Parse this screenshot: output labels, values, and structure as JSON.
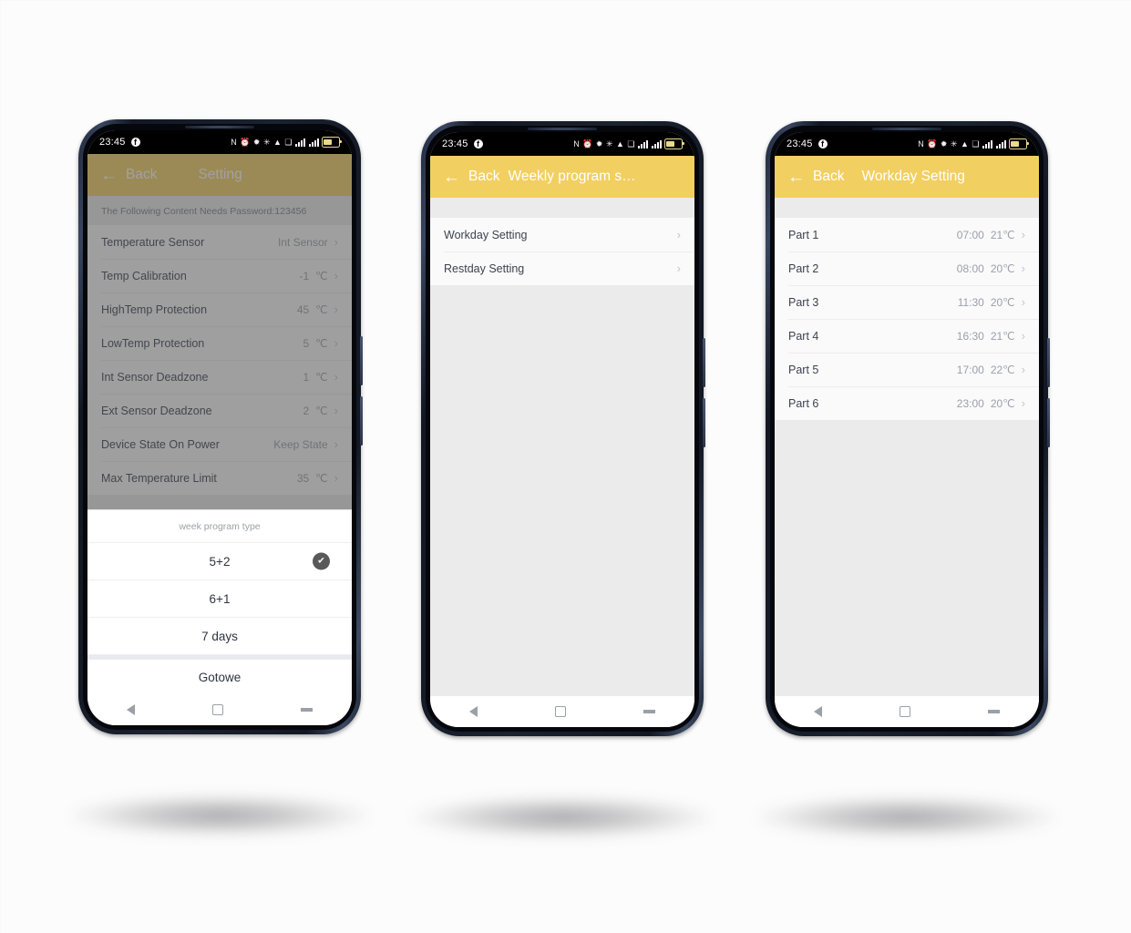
{
  "statusbar": {
    "time": "23:45",
    "facebook_badge": "f",
    "icons": [
      "nfc-icon",
      "alarm-icon",
      "location-off-icon",
      "bluetooth-icon",
      "wifi-icon",
      "vpn-key-icon",
      "signal-1-icon",
      "signal-2-icon",
      "battery-icon"
    ],
    "battery_level_pct": 62
  },
  "navbar": {
    "back": "nav-back-icon",
    "home": "nav-home-icon",
    "recents": "nav-recents-icon"
  },
  "colors": {
    "accent": "#f2cf61",
    "accent_dimmed": "#9b8a4b",
    "page_bg": "#ebebeb",
    "list_bg": "#fafafa",
    "label": "#3c4250",
    "value": "#9aa0ab",
    "canvas": "#fcfcfc"
  },
  "phone1": {
    "appbar": {
      "back_label": "Back",
      "title": "Setting",
      "back_icon": "arrow-left-icon"
    },
    "password_note": "The Following Content Needs Password:123456",
    "rows": [
      {
        "label": "Temperature Sensor",
        "value": "Int Sensor",
        "unit": ""
      },
      {
        "label": "Temp Calibration",
        "value": "-1",
        "unit": "℃"
      },
      {
        "label": "HighTemp Protection",
        "value": "45",
        "unit": "℃"
      },
      {
        "label": "LowTemp Protection",
        "value": "5",
        "unit": "℃"
      },
      {
        "label": "Int Sensor Deadzone",
        "value": "1",
        "unit": "℃"
      },
      {
        "label": "Ext Sensor Deadzone",
        "value": "2",
        "unit": "℃"
      },
      {
        "label": "Device State On Power",
        "value": "Keep State",
        "unit": ""
      },
      {
        "label": "Max Temperature Limit",
        "value": "35",
        "unit": "℃"
      }
    ],
    "sheet": {
      "title": "week program type",
      "options": [
        {
          "label": "5+2",
          "selected": true
        },
        {
          "label": "6+1",
          "selected": false
        },
        {
          "label": "7 days",
          "selected": false
        }
      ],
      "done_label": "Gotowe",
      "check_icon": "check-icon"
    }
  },
  "phone2": {
    "appbar": {
      "back_label": "Back",
      "title": "Weekly program s…",
      "back_icon": "arrow-left-icon"
    },
    "rows": [
      {
        "label": "Workday Setting"
      },
      {
        "label": "Restday Setting"
      }
    ]
  },
  "phone3": {
    "appbar": {
      "back_label": "Back",
      "title": "Workday Setting",
      "back_icon": "arrow-left-icon"
    },
    "rows": [
      {
        "label": "Part 1",
        "time": "07:00",
        "temp": "21℃"
      },
      {
        "label": "Part 2",
        "time": "08:00",
        "temp": "20℃"
      },
      {
        "label": "Part 3",
        "time": "11:30",
        "temp": "20℃"
      },
      {
        "label": "Part 4",
        "time": "16:30",
        "temp": "21℃"
      },
      {
        "label": "Part 5",
        "time": "17:00",
        "temp": "22℃"
      },
      {
        "label": "Part 6",
        "time": "23:00",
        "temp": "20℃"
      }
    ]
  }
}
